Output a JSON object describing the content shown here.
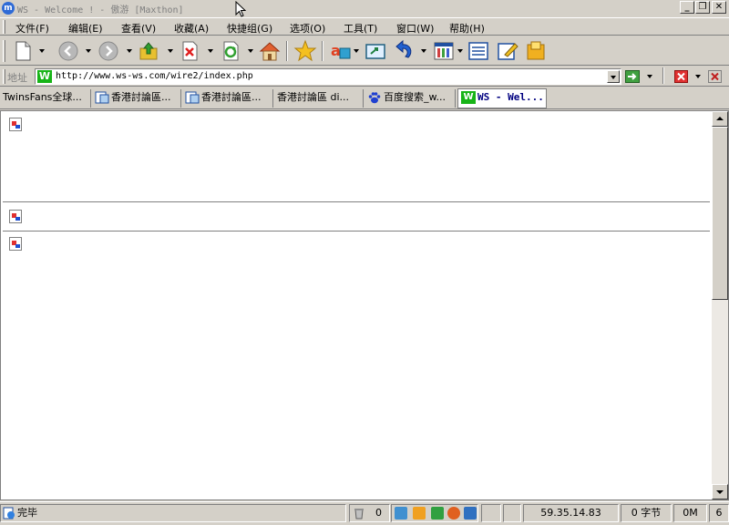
{
  "window": {
    "title": "WS - Welcome ! - 傲游 [Maxthon]",
    "controls": [
      "minimize",
      "maximize",
      "close"
    ]
  },
  "menu": {
    "items": [
      "文件(F)",
      "编辑(E)",
      "查看(V)",
      "收藏(A)",
      "快捷组(G)",
      "选项(O)",
      "工具(T)",
      "窗口(W)",
      "帮助(H)"
    ]
  },
  "toolbar": {
    "buttons": [
      "new-page",
      "back",
      "forward",
      "up-folder",
      "stop",
      "refresh",
      "home",
      "favorites",
      "translate",
      "screen-capture",
      "undo-close",
      "tools",
      "sidebar-panel",
      "edit-note",
      "plugin"
    ]
  },
  "address": {
    "label": "地址",
    "site_icon": "W",
    "url": "http://www.ws-ws.com/wire2/index.php"
  },
  "tabs": [
    {
      "label": "TwinsFans全球...",
      "icon": "none",
      "active": false
    },
    {
      "label": "香港討論區...",
      "icon": "page-icon",
      "active": false
    },
    {
      "label": "香港討論區...",
      "icon": "page-icon",
      "active": false
    },
    {
      "label": "香港討論區 di...",
      "icon": "none",
      "active": false
    },
    {
      "label": "百度搜索_w...",
      "icon": "baidu-paw-icon",
      "active": false
    },
    {
      "label": "WS - Wel...",
      "icon": "ws-icon",
      "active": true
    }
  ],
  "status": {
    "text": "完毕",
    "count": "0",
    "ip": "59.35.14.83",
    "bytes": "0 字节",
    "memory": "0M",
    "tabs_count": "6"
  },
  "colors": {
    "chrome": "#d4d0c8",
    "accent": "#18b418",
    "active_tab_text": "#000080"
  }
}
